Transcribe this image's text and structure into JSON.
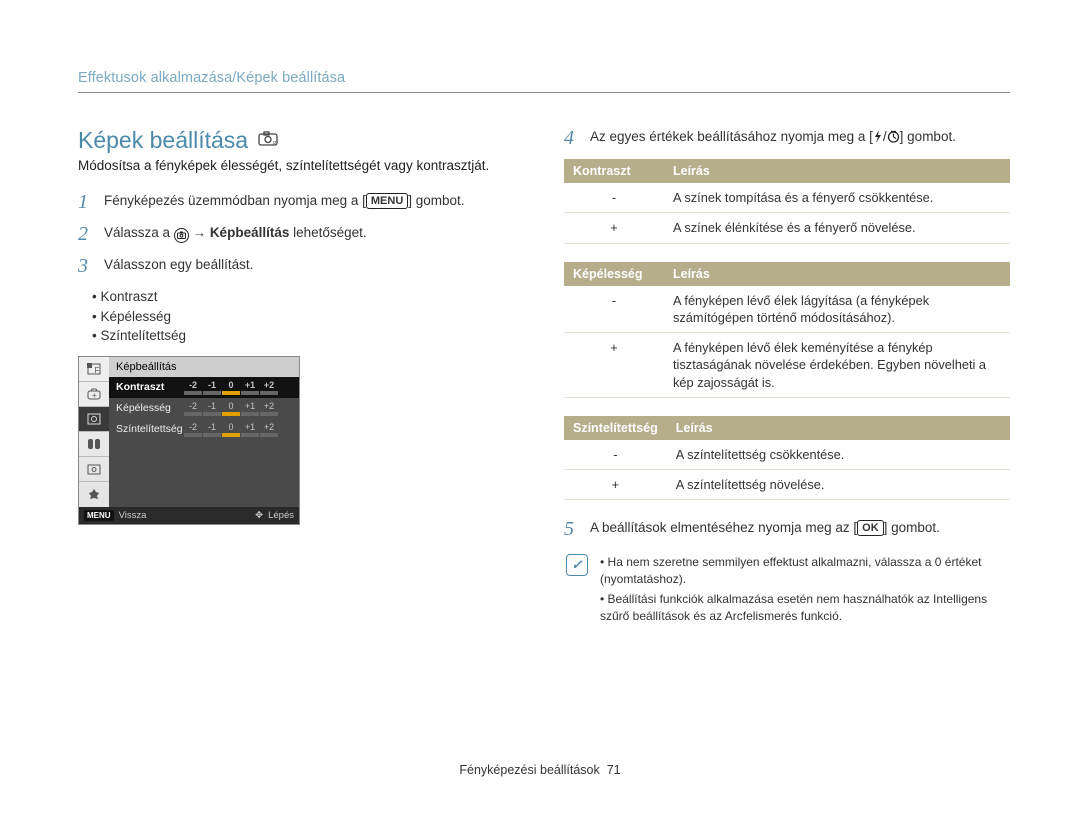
{
  "breadcrumb": "Effektusok alkalmazása/Képek beállítása",
  "title": "Képek beállítása",
  "intro": "Módosítsa a fényképek élességét, színtelítettségét vagy kontrasztját.",
  "steps_left": [
    {
      "n": "1",
      "pre": "Fényképezés üzemmódban nyomja meg a [",
      "btn": "MENU",
      "post": "] gombot."
    },
    {
      "n": "2",
      "pre": "Válassza a ",
      "arrow": " → ",
      "bold": "Képbeállítás",
      "post2": " lehetőséget.",
      "hasCameraIcon": true
    },
    {
      "n": "3",
      "text": "Válasszon egy beállítást."
    }
  ],
  "sublist": [
    "Kontraszt",
    "Képélesség",
    "Színtelítettség"
  ],
  "cam": {
    "title": "Képbeállítás",
    "rows": [
      {
        "label": "Kontraszt",
        "selected": true
      },
      {
        "label": "Képélesség",
        "selected": false
      },
      {
        "label": "Színtelítettség",
        "selected": false
      }
    ],
    "ticks": [
      "-2",
      "-1",
      "0",
      "+1",
      "+2"
    ],
    "foot_left_key": "MENU",
    "foot_left": "Vissza",
    "foot_right": "Lépés"
  },
  "steps_right": [
    {
      "n": "4",
      "pre": "Az egyes értékek beállításához nyomja meg a [",
      "icons": true,
      "post": "] gombot."
    }
  ],
  "tables": [
    {
      "head": [
        "Kontraszt",
        "Leírás"
      ],
      "rows": [
        [
          "-",
          "A színek tompítása és a fényerő csökkentése."
        ],
        [
          "+",
          "A színek élénkítése és a fényerő növelése."
        ]
      ]
    },
    {
      "head": [
        "Képélesség",
        "Leírás"
      ],
      "rows": [
        [
          "-",
          "A fényképen lévő élek lágyítása (a fényképek számítógépen történő módosításához)."
        ],
        [
          "+",
          "A fényképen lévő élek keményítése a fénykép tisztaságának növelése érdekében. Egyben növelheti a kép zajosságát is."
        ]
      ]
    },
    {
      "head": [
        "Színtelítettség",
        "Leírás"
      ],
      "rows": [
        [
          "-",
          "A színtelítettség csökkentése."
        ],
        [
          "+",
          "A színtelítettség növelése."
        ]
      ]
    }
  ],
  "step5": {
    "n": "5",
    "pre": "A beállítások elmentéséhez nyomja meg az [",
    "btn": "OK",
    "post": "] gombot."
  },
  "notes": [
    "Ha nem szeretne semmilyen effektust alkalmazni, válassza a 0 értéket (nyomtatáshoz).",
    "Beállítási funkciók alkalmazása esetén nem használhatók az Intelligens szűrő beállítások és az Arcfelismerés funkció."
  ],
  "footer_label": "Fényképezési beállítások",
  "footer_page": "71"
}
